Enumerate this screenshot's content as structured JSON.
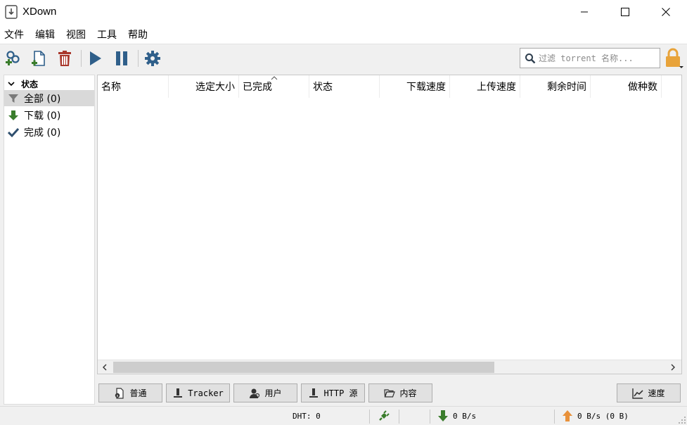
{
  "window": {
    "title": "XDown",
    "minimize_icon": "minimize-icon",
    "maximize_icon": "maximize-icon",
    "close_icon": "close-icon"
  },
  "menu": {
    "items": [
      "文件",
      "编辑",
      "视图",
      "工具",
      "帮助"
    ]
  },
  "toolbar": {
    "buttons": [
      "add-link-icon",
      "add-torrent-file-icon",
      "delete-icon",
      "start-icon",
      "pause-icon",
      "settings-icon"
    ],
    "search_placeholder": "过滤 torrent 名称...",
    "search_value": "",
    "lock_icon": "lock-icon"
  },
  "sidebar": {
    "header": "状态",
    "items": [
      {
        "label": "全部 (0)",
        "icon": "filter-icon",
        "selected": true
      },
      {
        "label": "下载 (0)",
        "icon": "download-arrow-icon",
        "selected": false
      },
      {
        "label": "完成 (0)",
        "icon": "checkmark-icon",
        "selected": false
      }
    ]
  },
  "table": {
    "columns": [
      "名称",
      "选定大小",
      "已完成",
      "状态",
      "下载速度",
      "上传速度",
      "剩余时间",
      "做种数"
    ],
    "sorted_column": "已完成",
    "rows": []
  },
  "bottom_tabs": {
    "general": "普通",
    "tracker": "Tracker",
    "peers": "用户",
    "http_sources": "HTTP 源",
    "content": "内容",
    "speed": "速度"
  },
  "statusbar": {
    "dht": "DHT: 0",
    "download_speed": "0 B/s",
    "upload_speed": "0 B/s (0 B)"
  },
  "colors": {
    "accent_green": "#3a7d2c",
    "accent_blue": "#2f5f8a",
    "delete_red": "#a9372b",
    "lock_orange": "#e8a33a",
    "upload_orange": "#e8913a"
  }
}
